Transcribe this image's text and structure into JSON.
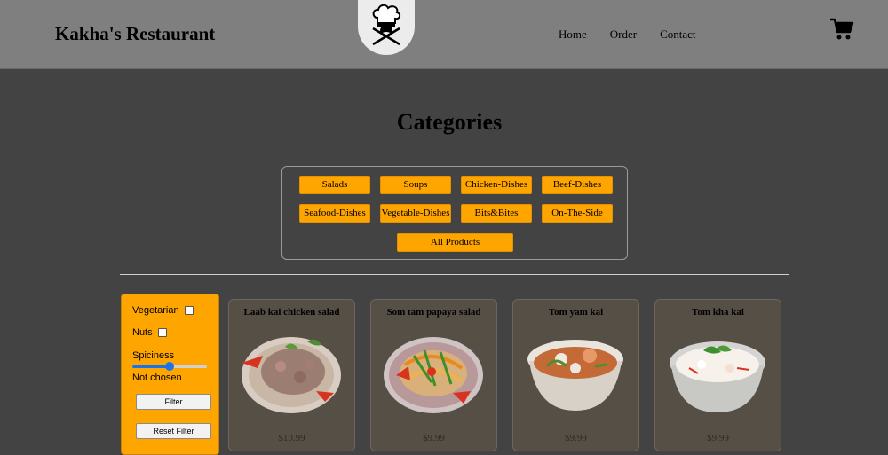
{
  "header": {
    "brand": "Kakha's Restaurant",
    "nav": [
      "Home",
      "Order",
      "Contact"
    ]
  },
  "page_title": "Categories",
  "categories": [
    "Salads",
    "Soups",
    "Chicken-Dishes",
    "Beef-Dishes",
    "Seafood-Dishes",
    "Vegetable-Dishes",
    "Bits&Bites",
    "On-The-Side",
    "All Products"
  ],
  "filter": {
    "vegetarian_label": "Vegetarian",
    "nuts_label": "Nuts",
    "spiciness_label": "Spiciness",
    "spiciness_status": "Not chosen",
    "spiciness_value": 0.5,
    "filter_button": "Filter",
    "reset_button": "Reset Filter"
  },
  "products": [
    {
      "name": "Laab kai chicken salad",
      "price": "$10.99"
    },
    {
      "name": "Som tam papaya salad",
      "price": "$9.99"
    },
    {
      "name": "Tom yam kai",
      "price": "$9.99"
    },
    {
      "name": "Tom kha kai",
      "price": "$9.99"
    }
  ],
  "colors": {
    "header_bg": "#7f7f7f",
    "page_bg": "#434343",
    "accent": "#ffa500",
    "card_bg": "#564f45"
  }
}
